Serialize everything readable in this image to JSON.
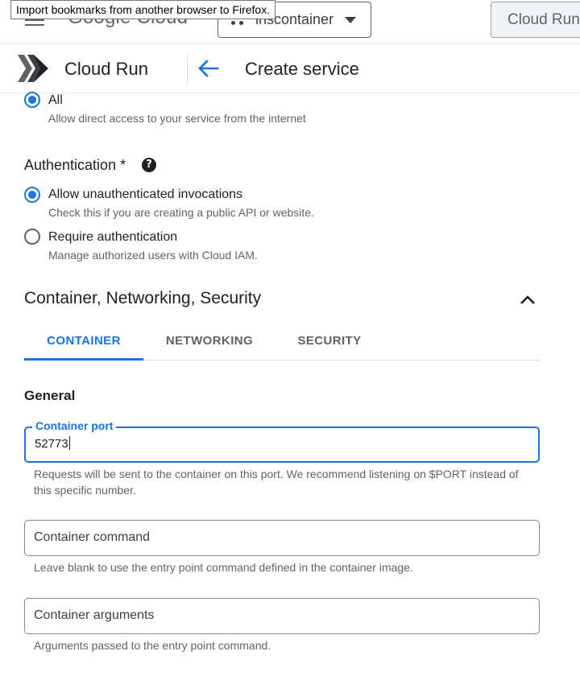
{
  "browser_tooltip": "Import bookmarks from another browser to Firefox.",
  "topbar": {
    "logo_text": "Google Cloud",
    "project_name": "inscontainer",
    "product_button": "Cloud Run"
  },
  "header": {
    "product_title": "Cloud Run",
    "page_title": "Create service"
  },
  "ingress": {
    "option_label": "All",
    "option_help": "Allow direct access to your service from the internet",
    "selected": true
  },
  "authentication": {
    "label": "Authentication *",
    "help_icon": "?",
    "options": [
      {
        "label": "Allow unauthenticated invocations",
        "help": "Check this if you are creating a public API or website.",
        "selected": true
      },
      {
        "label": "Require authentication",
        "help": "Manage authorized users with Cloud IAM.",
        "selected": false
      }
    ]
  },
  "section": {
    "title": "Container, Networking, Security",
    "expanded": true,
    "tabs": [
      {
        "label": "CONTAINER",
        "active": true
      },
      {
        "label": "NETWORKING",
        "active": false
      },
      {
        "label": "SECURITY",
        "active": false
      }
    ]
  },
  "general": {
    "heading": "General",
    "container_port": {
      "label": "Container port",
      "value": "52773",
      "help": "Requests will be sent to the container on this port. We recommend listening on $PORT instead of this specific number."
    },
    "container_command": {
      "placeholder": "Container command",
      "help": "Leave blank to use the entry point command defined in the container image."
    },
    "container_arguments": {
      "placeholder": "Container arguments",
      "help": "Arguments passed to the entry point command."
    }
  },
  "colors": {
    "accent": "#1a73e8",
    "text": "#202124",
    "secondary_text": "#5f6368",
    "border": "#80868b"
  },
  "icons": [
    "hamburger-menu-icon",
    "project-dots-icon",
    "dropdown-caret-icon",
    "cloud-run-logo-icon",
    "back-arrow-icon",
    "help-icon",
    "chevron-up-icon"
  ]
}
